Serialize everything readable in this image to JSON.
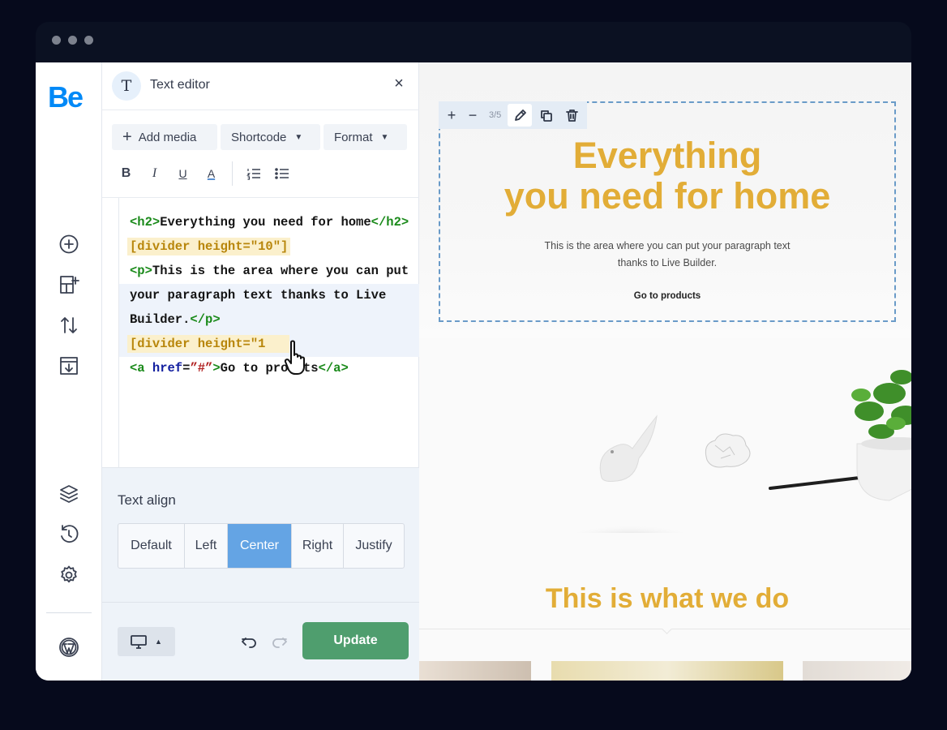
{
  "window": {
    "controls": [
      "dot",
      "dot",
      "dot"
    ]
  },
  "rail": {
    "logo": "Be",
    "items": [
      {
        "name": "add-element",
        "icon": "plus-circle-icon"
      },
      {
        "name": "sections",
        "icon": "layout-plus-icon"
      },
      {
        "name": "sort",
        "icon": "sort-arrows-icon"
      },
      {
        "name": "import",
        "icon": "import-icon"
      },
      {
        "name": "layers",
        "icon": "layers-icon"
      },
      {
        "name": "history",
        "icon": "history-icon"
      },
      {
        "name": "settings",
        "icon": "gear-icon"
      },
      {
        "name": "wordpress",
        "icon": "wordpress-icon"
      }
    ]
  },
  "panel": {
    "badge": "T",
    "title": "Text editor",
    "close": "×",
    "toolbar": {
      "add_media": "Add media",
      "shortcode": "Shortcode",
      "format": "Format",
      "bold": "B",
      "italic": "I",
      "underline": "U",
      "color": "A"
    },
    "code": {
      "l1_open": "<h2>",
      "l1_text": "Everything you need for home",
      "l1_close": "</h2>",
      "l2": "[divider height=\"10\"]",
      "l3_open": "<p>",
      "l3_text": "This is the area where you can put your paragraph text thanks to Live Builder.",
      "l3_close": "</p>",
      "l4": "[divider height=\"1",
      "l5_open": "<a ",
      "l5_attr": "href",
      "l5_eq": "=",
      "l5_val": "”#”",
      "l5_gt": ">",
      "l5_text": "Go to proucts",
      "l5_close": "</a>"
    },
    "text_align": {
      "label": "Text align",
      "options": [
        "Default",
        "Left",
        "Center",
        "Right",
        "Justify"
      ],
      "selected": "Center"
    },
    "footer": {
      "update": "Update",
      "device": "desktop-icon"
    }
  },
  "canvas": {
    "tools": {
      "plus": "+",
      "minus": "−",
      "count": "3/5"
    },
    "hero": {
      "title_1": "Everything",
      "title_2": "you need for home",
      "paragraph": "This is the area where you can put your paragraph text thanks to Live Builder.",
      "link": "Go to products"
    },
    "section_title": "This is what we do",
    "colors": {
      "accent": "#e2ad37",
      "update": "#4f9e6e",
      "active_align": "#64a4e4",
      "selection": "#6a9bc8"
    }
  }
}
